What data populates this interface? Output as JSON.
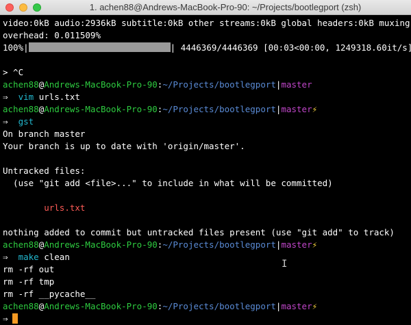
{
  "window": {
    "title": "1. achen88@Andrews-MacBook-Pro-90: ~/Projects/bootlegport (zsh)"
  },
  "output": {
    "ffmpeg_line1": "video:0kB audio:2936kB subtitle:0kB other streams:0kB global headers:0kB muxing",
    "ffmpeg_line2": "overhead: 0.011509%",
    "progress_percent": "100%|",
    "progress_fill": 1.0,
    "progress_tail": "| 4446369/4446369 [00:03<00:00, 1249318.60it/s]",
    "interrupt": "> ^C"
  },
  "prompts": [
    {
      "user": "achen88",
      "at": "@",
      "host": "Andrews-MacBook-Pro-90",
      "colon": ":",
      "path": "~/Projects/bootlegport",
      "sep": "|",
      "branch": "master",
      "dirty": "",
      "arrow": "⇒",
      "command": "vim",
      "args": " urls.txt"
    },
    {
      "user": "achen88",
      "at": "@",
      "host": "Andrews-MacBook-Pro-90",
      "colon": ":",
      "path": "~/Projects/bootlegport",
      "sep": "|",
      "branch": "master",
      "dirty": "⚡",
      "arrow": "⇒",
      "command": "gst",
      "args": ""
    },
    {
      "user": "achen88",
      "at": "@",
      "host": "Andrews-MacBook-Pro-90",
      "colon": ":",
      "path": "~/Projects/bootlegport",
      "sep": "|",
      "branch": "master",
      "dirty": "⚡",
      "arrow": "⇒",
      "command": "make",
      "args": " clean"
    },
    {
      "user": "achen88",
      "at": "@",
      "host": "Andrews-MacBook-Pro-90",
      "colon": ":",
      "path": "~/Projects/bootlegport",
      "sep": "|",
      "branch": "master",
      "dirty": "⚡",
      "arrow": "⇒",
      "command": "",
      "args": ""
    }
  ],
  "git_status": {
    "on_branch": "On branch master",
    "up_to_date": "Your branch is up to date with 'origin/master'.",
    "untracked_header": "Untracked files:",
    "hint": "  (use \"git add <file>...\" to include in what will be committed)",
    "untracked_file": "urls.txt",
    "summary": "nothing added to commit but untracked files present (use \"git add\" to track)"
  },
  "make_output": [
    "rm -rf out",
    "rm -rf tmp",
    "rm -rf __pycache__"
  ]
}
